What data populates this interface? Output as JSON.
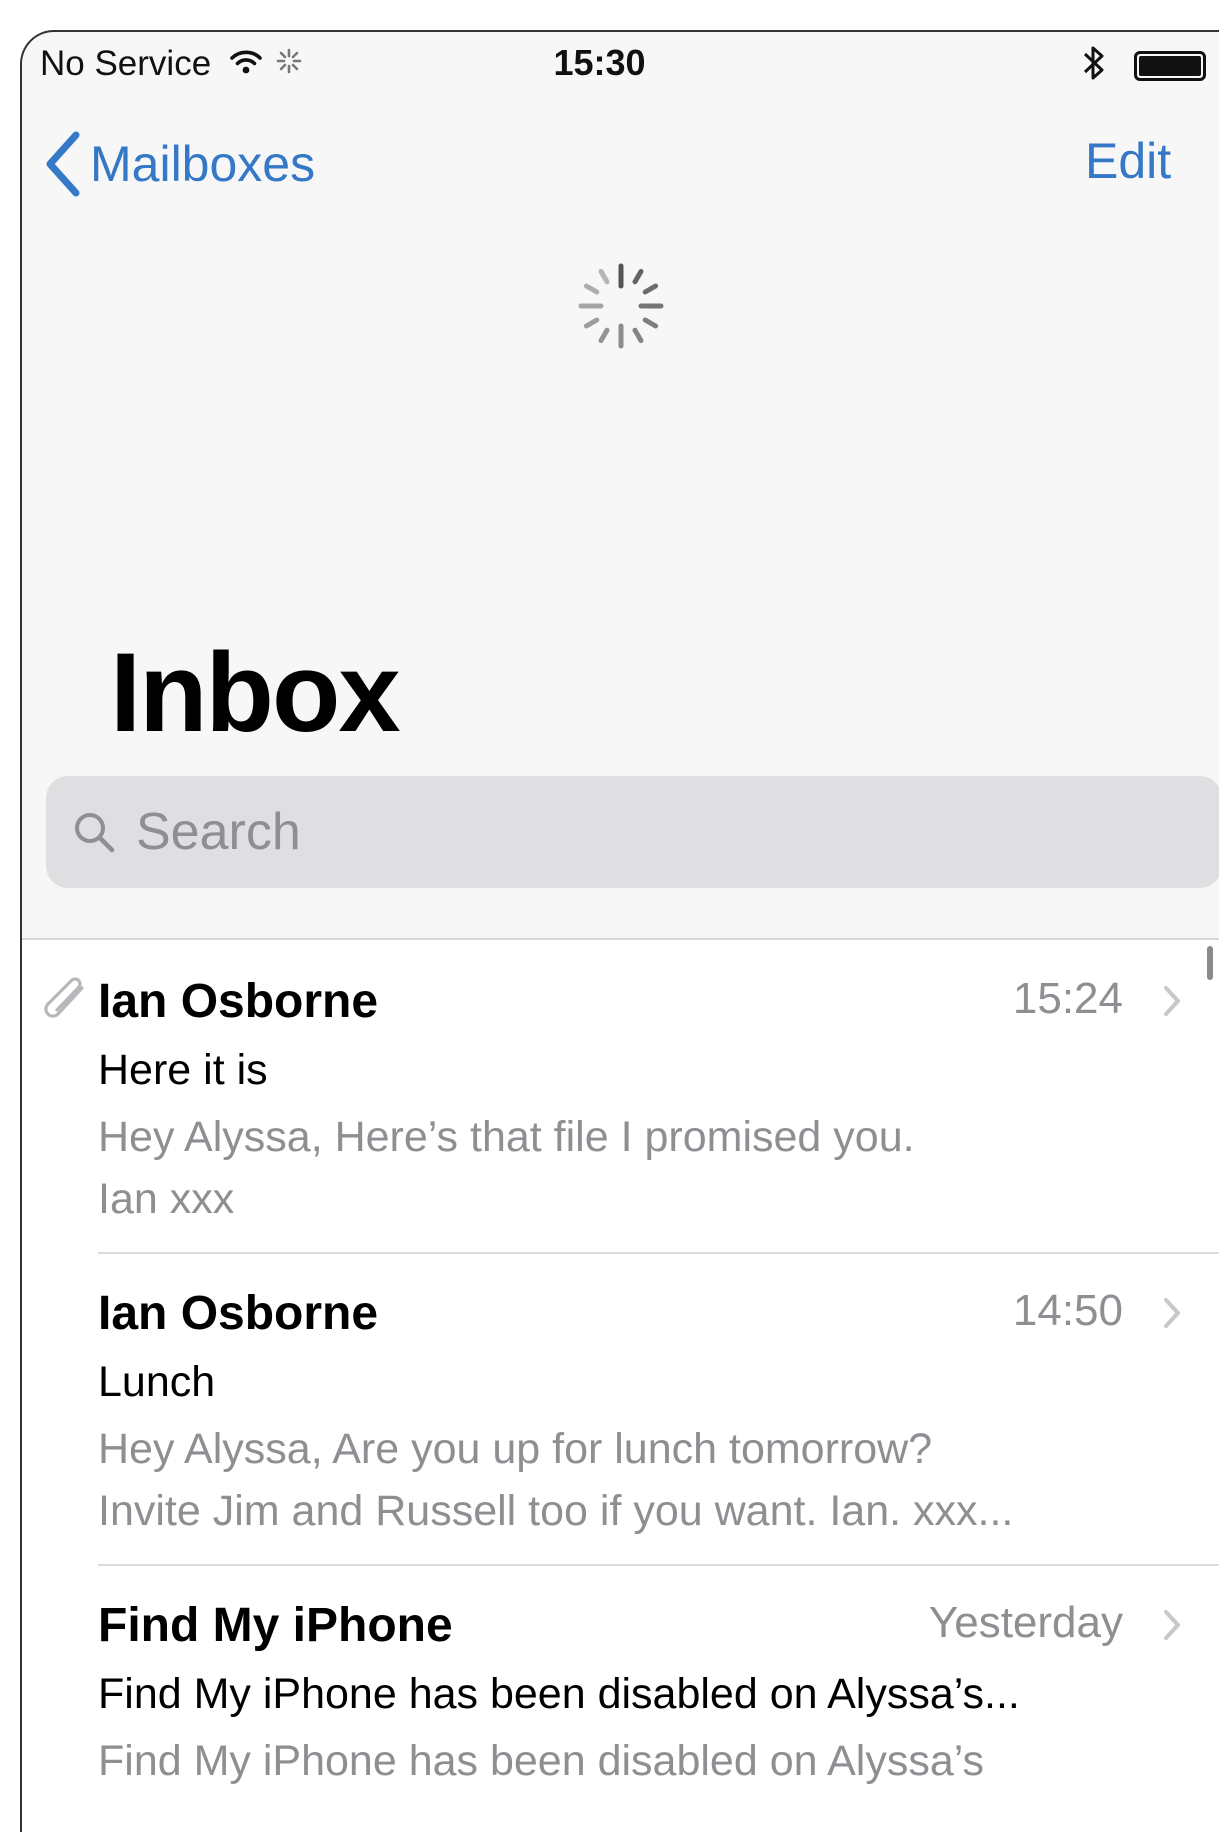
{
  "status_bar": {
    "carrier": "No Service",
    "time": "15:30",
    "battery_level": 1.0
  },
  "nav": {
    "back_label": "Mailboxes",
    "edit_label": "Edit"
  },
  "page_title": "Inbox",
  "search": {
    "placeholder": "Search"
  },
  "messages": [
    {
      "sender": "Ian Osborne",
      "time": "15:24",
      "subject": "Here it is",
      "preview_line1": "Hey Alyssa, Here’s that file I promised you.",
      "preview_line2": "Ian xxx",
      "has_attachment": true
    },
    {
      "sender": "Ian Osborne",
      "time": "14:50",
      "subject": "Lunch",
      "preview_line1": "Hey Alyssa, Are you up for lunch tomorrow?",
      "preview_line2": "Invite Jim and Russell too if you want. Ian. xxx...",
      "has_attachment": false
    },
    {
      "sender": "Find My iPhone",
      "time": "Yesterday",
      "subject": "Find My iPhone has been disabled on Alyssa’s...",
      "preview_line1": "Find My iPhone has been disabled on Alyssa’s",
      "preview_line2": "",
      "has_attachment": false
    }
  ],
  "colors": {
    "accent": "#3478c6",
    "secondary_text": "#8e8e93",
    "background": "#f7f7f7",
    "search_fill": "#dfdfe2"
  }
}
